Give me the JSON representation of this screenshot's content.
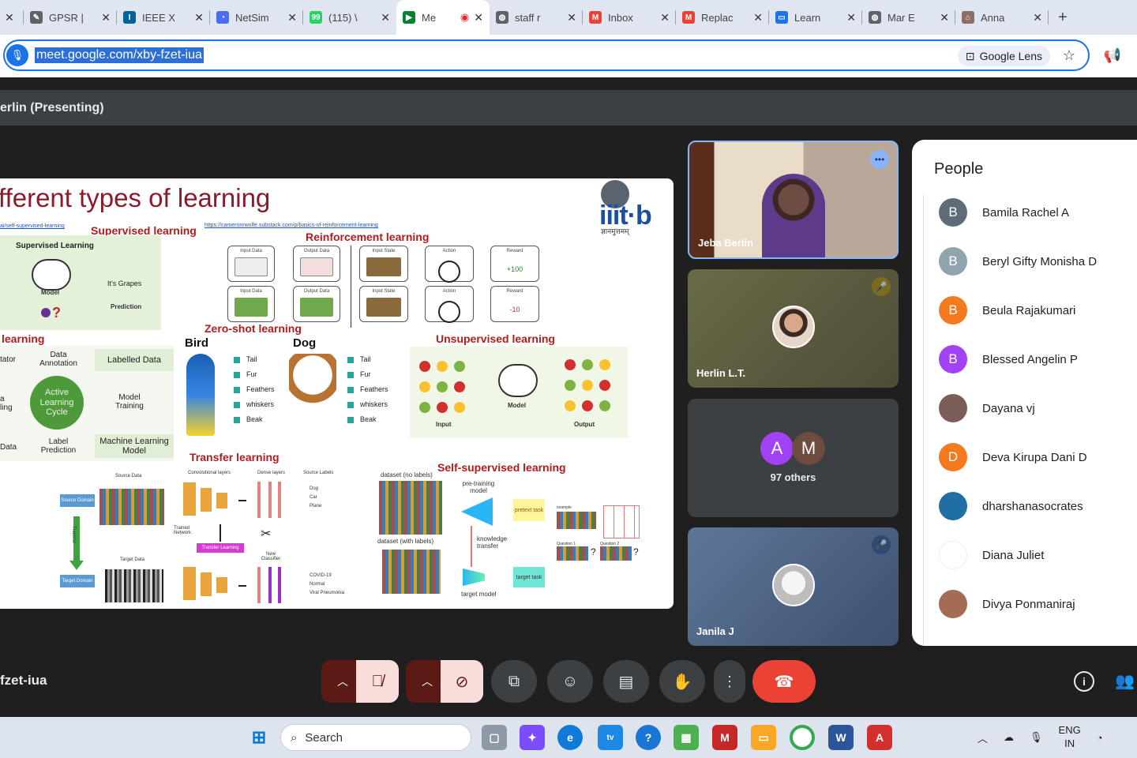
{
  "tabs": [
    {
      "label": "GPSR |",
      "fav_color": "#5f6368",
      "fav_glyph": "✎"
    },
    {
      "label": "IEEE X",
      "fav_color": "#00629b",
      "fav_glyph": "I"
    },
    {
      "label": "NetSim",
      "fav_color": "#4a6cf7",
      "fav_glyph": "◔"
    },
    {
      "label": "(115) \\",
      "fav_color": "#25d366",
      "fav_glyph": "99"
    },
    {
      "label": "Me",
      "fav_color": "#00832d",
      "fav_glyph": "▶"
    },
    {
      "label": "staff r",
      "fav_color": "#5f6368",
      "fav_glyph": "◍"
    },
    {
      "label": "Inbox",
      "fav_color": "#ea4335",
      "fav_glyph": "M"
    },
    {
      "label": "Replac",
      "fav_color": "#ea4335",
      "fav_glyph": "M"
    },
    {
      "label": "Learn",
      "fav_color": "#1a73e8",
      "fav_glyph": "▭"
    },
    {
      "label": "Mar E",
      "fav_color": "#5f6368",
      "fav_glyph": "◍"
    },
    {
      "label": "Anna",
      "fav_color": "#8d6e63",
      "fav_glyph": "⌂"
    }
  ],
  "new_tab": "+",
  "url": "meet.google.com/xby-fzet-iua",
  "google_lens": "Google Lens",
  "presenter_bar": "erlin (Presenting)",
  "slide": {
    "title": "fferent types of learning",
    "logo_text": "iiit·b",
    "logo_sub": "ज्ञानमुत्तमम्",
    "supervised": "Supervised learning",
    "supervised_link": "https://cameronrwolfe.substack.com/p/basics-of-reinforcement-learning",
    "left_link": "ai/self-supervised-learning",
    "supervised_panel_title": "Supervised Learning",
    "grapes": "It's Grapes",
    "model": "Model",
    "prediction": "Prediction",
    "reinforcement": "Reinforcement learning",
    "rl_input_data": "Input Data",
    "rl_output_data": "Output Data",
    "rl_input_state": "Input State",
    "rl_action": "Action",
    "rl_reward": "Reward",
    "rl_reward_pos": "+100",
    "rl_reward_neg": "-10",
    "zero_shot": "Zero-shot learning",
    "bird": "Bird",
    "dog": "Dog",
    "features": [
      "Tail",
      "Fur",
      "Feathers",
      "whiskers",
      "Beak"
    ],
    "active_learning": "learning",
    "annotator": "tator",
    "data_annotation": "Data Annotation",
    "labelled_data": "Labelled Data",
    "cycle": "Active Learning Cycle",
    "model_training": "Model Training",
    "a_ling": "a ling",
    "left_data": "Data",
    "label_prediction": "Label Prediction",
    "ml_model": "Machine Learning Model",
    "unsupervised": "Unsupervised learning",
    "uns_input": "Input",
    "uns_model": "Model",
    "uns_output": "Output",
    "transfer": "Transfer learning",
    "conv_layers": "Convolutional layers",
    "dense_layers": "Dense layers",
    "source_labels": "Source Labels",
    "source_data": "Source Data",
    "source_domain": "Source Domain",
    "transfer_arrow": "Transfer",
    "target_data": "Target Data",
    "target_domain": "Target Domain",
    "trained_network": "Trained Network",
    "transfer_learning_tag": "Transfer Learning",
    "new_classifier": "New Classifier",
    "src_classes": [
      "Dog",
      "Car",
      "Plane"
    ],
    "tgt_classes": [
      "COVID-19",
      "Normal",
      "Viral Pneumonia"
    ],
    "self_supervised": "Self-supervised learning",
    "ss_dataset_no_labels": "dataset (no labels)",
    "ss_dataset_labels": "dataset (with labels)",
    "ss_pretraining": "pre-training model",
    "ss_pretext": "pretext task",
    "ss_knowledge": "knowledge transfer",
    "ss_target_task": "target task",
    "ss_target_model": "target model",
    "ss_example": "example",
    "ss_q1": "Question 1",
    "ss_q2": "Question 2",
    "ss_qmark": "?"
  },
  "participants": [
    {
      "name": "Jeba Berlin",
      "badge": "•••"
    },
    {
      "name": "Herlin L.T.",
      "badge": "🎤̸"
    },
    {
      "name": "97 others",
      "av1": "A",
      "av2": "M"
    },
    {
      "name": "Janila J",
      "badge": "🎤̸"
    }
  ],
  "people_panel": {
    "title": "People",
    "rows": [
      {
        "name": "Bamila Rachel A",
        "initial": "B",
        "color": "#5f6b78"
      },
      {
        "name": "Beryl Gifty Monisha D",
        "initial": "B",
        "color": "#90a4ae"
      },
      {
        "name": "Beula Rajakumari",
        "initial": "B",
        "color": "#f4791f"
      },
      {
        "name": "Blessed Angelin P",
        "initial": "B",
        "color": "#a142f4"
      },
      {
        "name": "Dayana vj",
        "initial": "",
        "color": "#7b5e57"
      },
      {
        "name": "Deva Kirupa Dani D",
        "initial": "D",
        "color": "#f4791f"
      },
      {
        "name": "dharshanasocrates",
        "initial": "",
        "color": "#1f6fa5"
      },
      {
        "name": "Diana Juliet",
        "initial": "",
        "color": "#ffffff"
      },
      {
        "name": "Divya Ponmaniraj",
        "initial": "",
        "color": "#a46b55"
      }
    ]
  },
  "meet_code": "fzet-iua",
  "taskbar": {
    "search": "Search",
    "lang_top": "ENG",
    "lang_bottom": "IN"
  }
}
